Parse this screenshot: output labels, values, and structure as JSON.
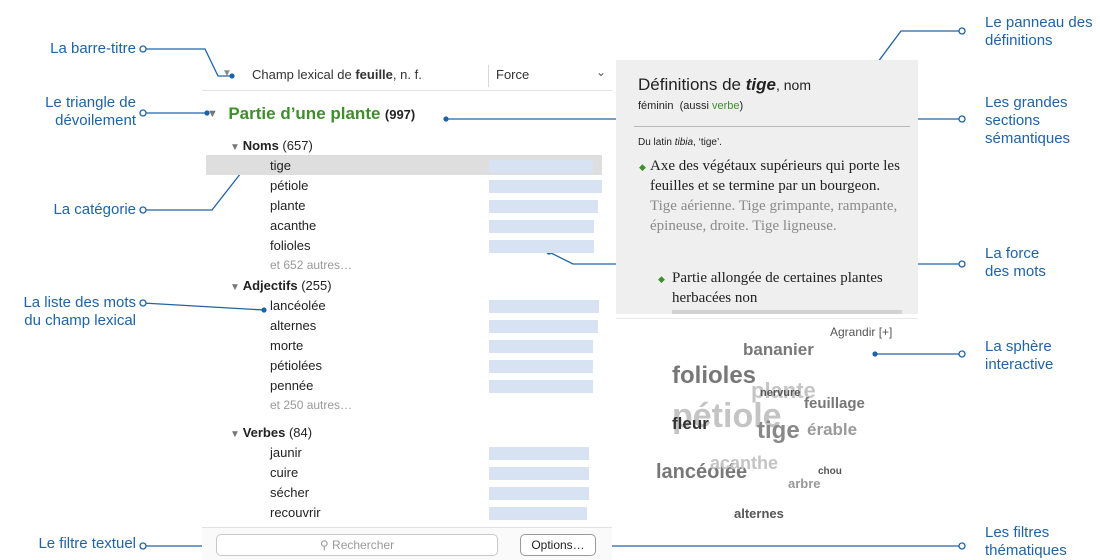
{
  "annotations": {
    "barre_titre": "La barre-titre",
    "triangle_line1": "Le triangle de",
    "triangle_line2": "dévoilement",
    "categorie": "La catégorie",
    "liste_line1": "La liste des mots",
    "liste_line2": "du champ lexical",
    "filtre_textuel": "Le filtre textuel",
    "panneau_line1": "Le panneau des",
    "panneau_line2": "définitions",
    "sections_line1": "Les grandes",
    "sections_line2": "sections",
    "sections_line3": "sémantiques",
    "force_line1": "La force",
    "force_line2": "des mots",
    "sphere_line1": "La sphère",
    "sphere_line2": "interactive",
    "filtres_line1": "Les filtres",
    "filtres_line2": "thématiques"
  },
  "titlebar": {
    "prefix": "Champ lexical de ",
    "word": "feuille",
    "suffix": ", n. f.",
    "sort_label": "Force"
  },
  "section": {
    "name": "Partie d’une plante",
    "count": "(997)"
  },
  "categories": [
    {
      "name": "Noms",
      "count": "(657)",
      "words": [
        {
          "label": "tige",
          "force": 0.88
        },
        {
          "label": "pétiole",
          "force": 0.96
        },
        {
          "label": "plante",
          "force": 0.92
        },
        {
          "label": "acanthe",
          "force": 0.89
        },
        {
          "label": "folioles",
          "force": 0.89
        }
      ],
      "more": "et 652 autres…"
    },
    {
      "name": "Adjectifs",
      "count": "(255)",
      "words": [
        {
          "label": "lancéolée",
          "force": 0.93
        },
        {
          "label": "alternes",
          "force": 0.92
        },
        {
          "label": "morte",
          "force": 0.88
        },
        {
          "label": "pétiolées",
          "force": 0.88
        },
        {
          "label": "pennée",
          "force": 0.88
        }
      ],
      "more": "et 250 autres…"
    },
    {
      "name": "Verbes",
      "count": "(84)",
      "words": [
        {
          "label": "jaunir",
          "force": 0.85
        },
        {
          "label": "cuire",
          "force": 0.85
        },
        {
          "label": "sécher",
          "force": 0.85
        },
        {
          "label": "recouvrir",
          "force": 0.83
        }
      ],
      "more": ""
    }
  ],
  "search": {
    "placeholder": "Rechercher"
  },
  "options_label": "Options…",
  "definition": {
    "title_prefix": "Définitions de ",
    "headword": "tige",
    "pos": ", nom",
    "gender": "féminin",
    "aussi_prefix": "(aussi ",
    "aussi_word": "verbe",
    "aussi_suffix": ")",
    "etym_prefix": "Du latin ",
    "etym_word": "tibia",
    "etym_suffix": ", ‘tige’.",
    "sense1": "Axe des végétaux supérieurs qui porte les feuilles et se termine par un bourgeon.",
    "sense1_examples": "Tige aérienne. Tige grimpante, rampante, épineuse, droite. Tige ligneuse.",
    "sense2": "Partie allongée de certaines plantes herbacées non"
  },
  "sphere": {
    "agrandir": "Agrandir [+]",
    "words": [
      "bananier",
      "folioles",
      "plante",
      "nervure",
      "feuillage",
      "pétiole",
      "fleur",
      "tige",
      "érable",
      "lancéolée",
      "acanthe",
      "chou",
      "arbre",
      "alternes"
    ]
  },
  "colors": {
    "accent_blue": "#1f63a6",
    "section_green": "#3e8e2c",
    "force_bar": "#d7e3f3",
    "selection": "#dedede"
  }
}
